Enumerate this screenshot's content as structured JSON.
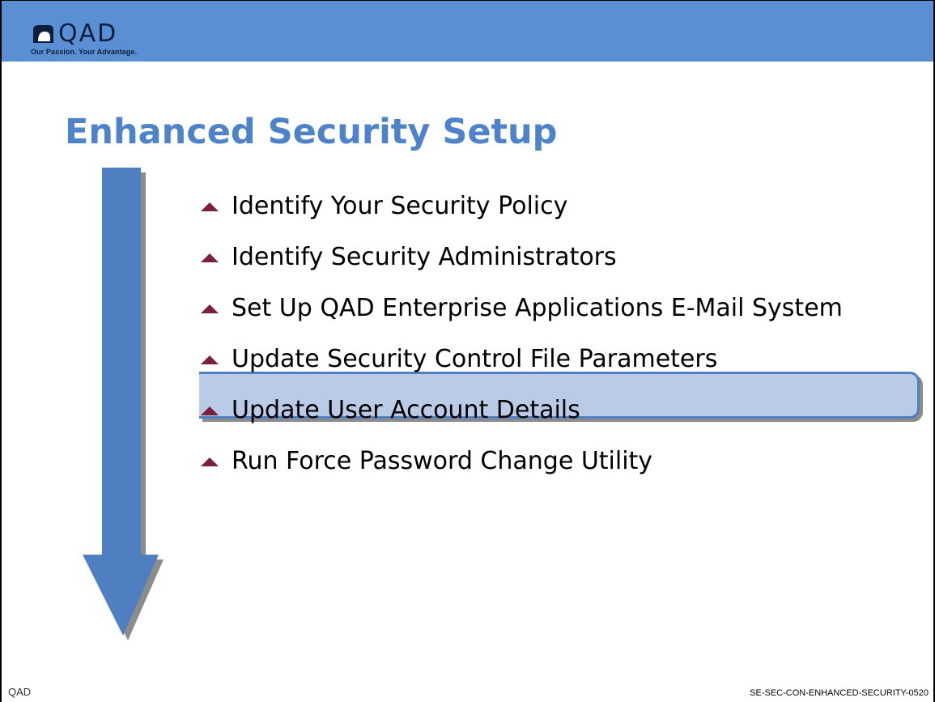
{
  "header": {
    "logo_word": "QAD",
    "logo_tagline": "Our Passion. Your Advantage."
  },
  "slide": {
    "title": "Enhanced Security Setup",
    "bullets": [
      {
        "text": "Identify Your Security Policy",
        "highlighted": false
      },
      {
        "text": "Identify Security Administrators",
        "highlighted": false
      },
      {
        "text": "Set Up QAD Enterprise Applications E-Mail System",
        "highlighted": false
      },
      {
        "text": "Update Security Control File Parameters",
        "highlighted": false
      },
      {
        "text": "Update User Account Details",
        "highlighted": true
      },
      {
        "text": "Run Force Password Change Utility",
        "highlighted": false
      }
    ]
  },
  "footer": {
    "left": "QAD",
    "right": "SE-SEC-CON-ENHANCED-SECURITY-0520"
  },
  "colors": {
    "header_bar": "#5b8fd3",
    "title": "#4f83c9",
    "arrow": "#4f7fc0",
    "bullet_marker": "#7a1f3d",
    "highlight_fill": "#b9cbe6",
    "highlight_border": "#4f7fc0"
  },
  "icons": {
    "logo": "qad-logo-icon",
    "bullet": "triangle-up-bullet-icon",
    "progress_arrow": "down-arrow-icon"
  }
}
